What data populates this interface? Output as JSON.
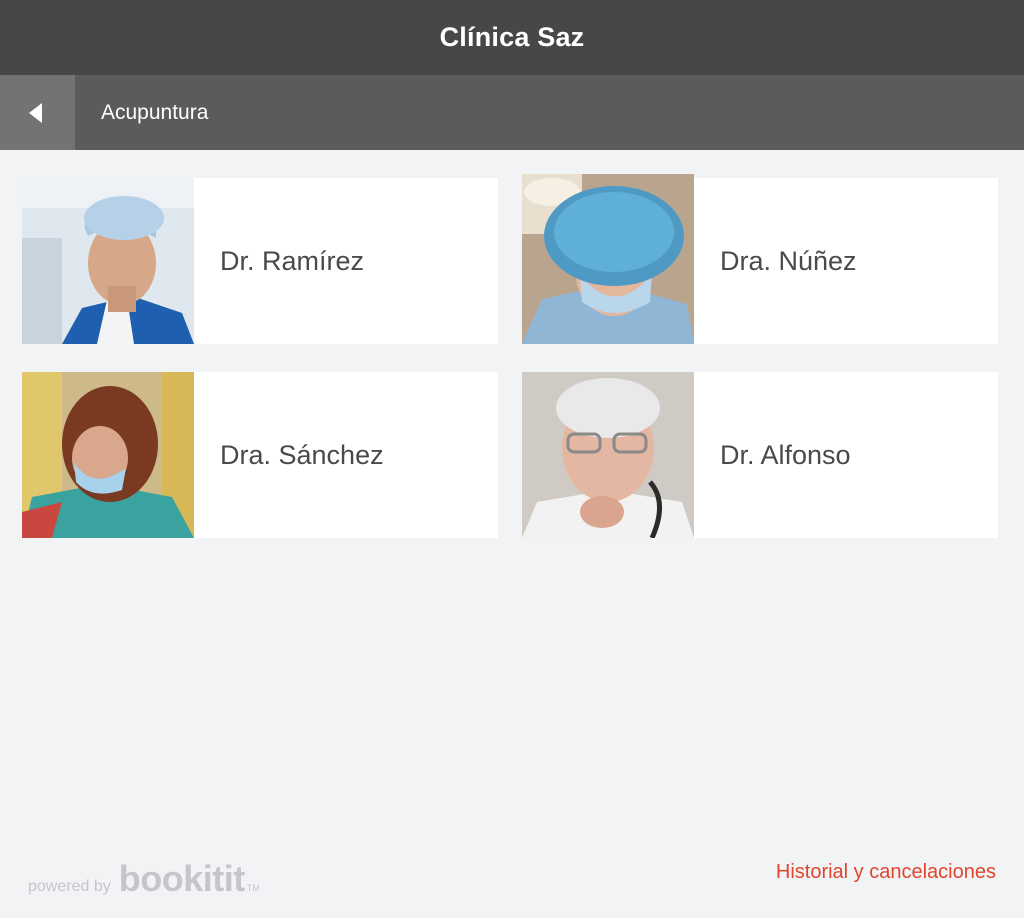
{
  "app": {
    "title": "Clínica Saz"
  },
  "subheader": {
    "breadcrumb": "Acupuntura",
    "back_icon": "triangle-left-icon"
  },
  "doctors": [
    {
      "name": "Dr. Ramírez"
    },
    {
      "name": "Dra. Núñez"
    },
    {
      "name": "Dra. Sánchez"
    },
    {
      "name": "Dr. Alfonso"
    }
  ],
  "footer": {
    "powered_small": "powered by",
    "powered_brand": "bookitit",
    "powered_tm": "TM",
    "history_link": "Historial y cancelaciones"
  },
  "colors": {
    "topbar": "#474747",
    "subbar": "#5b5b5b",
    "back_button": "#737373",
    "background": "#f2f3f5",
    "link": "#e0452d"
  }
}
